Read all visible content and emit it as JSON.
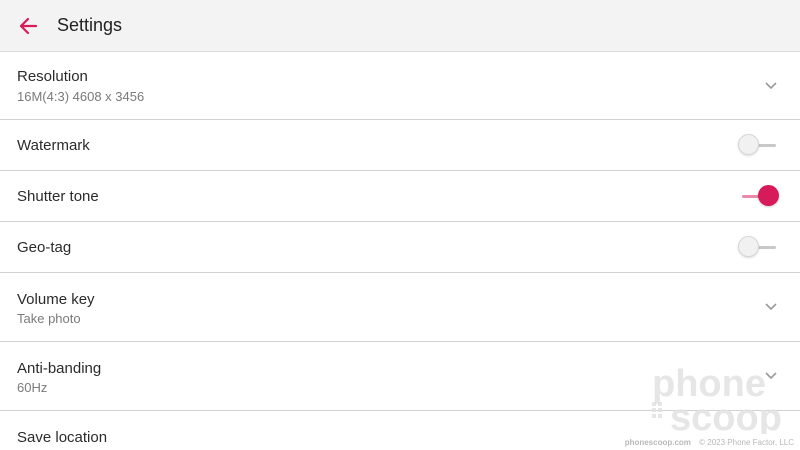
{
  "appbar": {
    "title": "Settings",
    "accent_color": "#d61a5a",
    "back_icon": "arrow-left-icon"
  },
  "settings": [
    {
      "id": "resolution",
      "label": "Resolution",
      "value": "16M(4:3) 4608 x 3456",
      "control": "dropdown"
    },
    {
      "id": "watermark",
      "label": "Watermark",
      "control": "toggle",
      "checked": false
    },
    {
      "id": "shutter-tone",
      "label": "Shutter tone",
      "control": "toggle",
      "checked": true
    },
    {
      "id": "geo-tag",
      "label": "Geo-tag",
      "control": "toggle",
      "checked": false
    },
    {
      "id": "volume-key",
      "label": "Volume key",
      "value": "Take photo",
      "control": "dropdown"
    },
    {
      "id": "anti-banding",
      "label": "Anti-banding",
      "value": "60Hz",
      "control": "dropdown"
    },
    {
      "id": "save-location",
      "label": "Save location",
      "control": "dropdown"
    }
  ],
  "watermark": {
    "logo_line1": "phone",
    "logo_line2": "scoop",
    "site": "phonescoop.com",
    "copyright": "© 2023 Phone Factor, LLC"
  }
}
